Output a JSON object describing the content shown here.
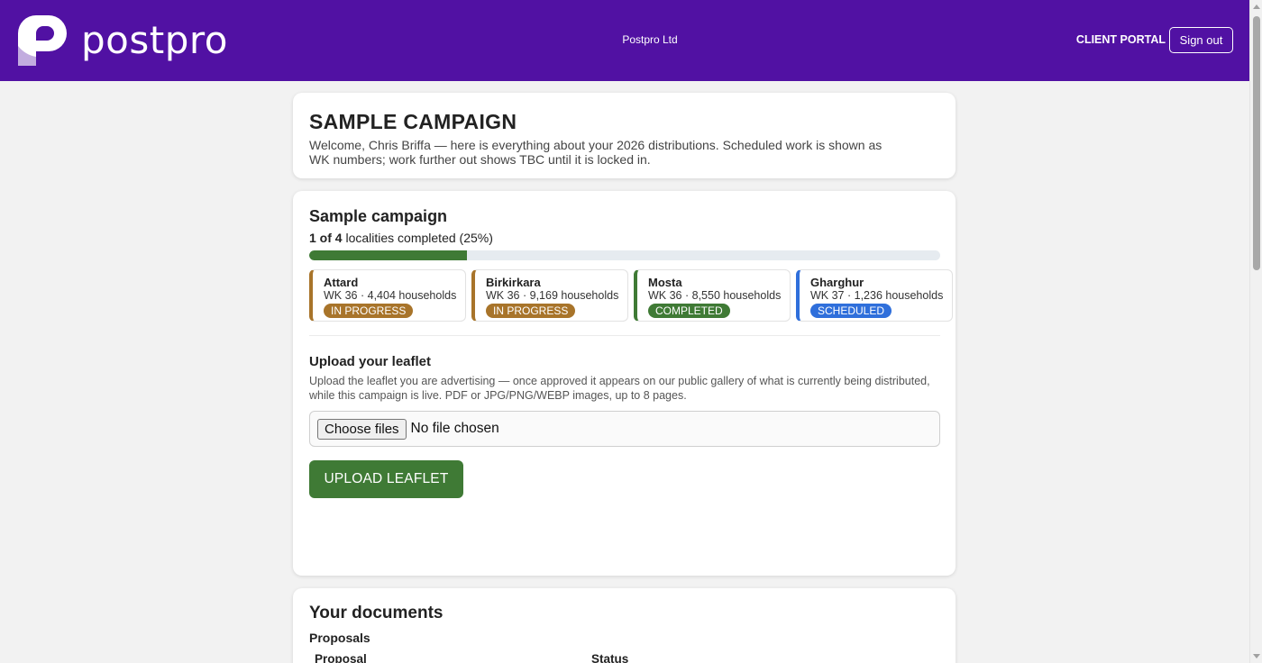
{
  "header": {
    "brand_name": "postpro",
    "company": "Postpro Ltd",
    "portal_label": "CLIENT PORTAL",
    "signout_label": "Sign out",
    "bg_color": "#5111a3"
  },
  "welcome": {
    "title": "SAMPLE CAMPAIGN",
    "text": "Welcome, Chris Briffa — here is everything about your 2026 distributions. Scheduled work is shown as WK numbers; work further out shows TBC until it is locked in."
  },
  "campaign": {
    "title": "Sample campaign",
    "completed_count": "1 of 4",
    "completed_suffix": " localities completed (25%)",
    "progress_fraction": 0.25,
    "localities": [
      {
        "name": "Attard",
        "meta": "WK 36 · 4,404 households",
        "status": "IN PROGRESS",
        "color": "#a8742a"
      },
      {
        "name": "Birkirkara",
        "meta": "WK 36 · 9,169 households",
        "status": "IN PROGRESS",
        "color": "#a8742a"
      },
      {
        "name": "Mosta",
        "meta": "WK 36 · 8,550 households",
        "status": "COMPLETED",
        "color": "#3f7a35"
      },
      {
        "name": "Gharghur",
        "meta": "WK 37 · 1,236 households",
        "status": "SCHEDULED",
        "color": "#2f6fdb"
      }
    ]
  },
  "upload": {
    "title": "Upload your leaflet",
    "description": "Upload the leaflet you are advertising — once approved it appears on our public gallery of what is currently being distributed, while this campaign is live. PDF or JPG/PNG/WEBP images, up to 8 pages.",
    "choose_label": "Choose files",
    "no_file_label": "No file chosen",
    "button_label": "UPLOAD LEAFLET"
  },
  "documents": {
    "title": "Your documents",
    "proposals_label": "Proposals",
    "columns": [
      "Proposal",
      "Status"
    ]
  }
}
